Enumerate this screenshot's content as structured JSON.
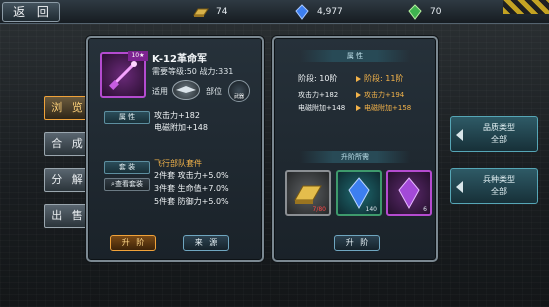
{
  "top": {
    "back_label": "返 回",
    "resources": [
      {
        "icon": "gold-bar-icon",
        "value": "74"
      },
      {
        "icon": "blue-crystal-icon",
        "value": "4,977"
      },
      {
        "icon": "green-crystal-icon",
        "value": "70"
      }
    ]
  },
  "tabs": [
    "浏 览",
    "合 成",
    "分 解",
    "出 售"
  ],
  "filters": [
    {
      "line1": "品质类型",
      "line2": "全部"
    },
    {
      "line1": "兵种类型",
      "line2": "全部"
    }
  ],
  "item": {
    "level_badge": "10★",
    "name": "K-12革命军",
    "req_line": "需要等级:50   战力:331",
    "fit_label": "适用",
    "part_label": "部位",
    "part_icon_text": "武器",
    "attr_tag": "属 性",
    "attack": "攻击力+182",
    "emp": "电磁附加+148",
    "set_tag": "套 装",
    "set_view": "查看套装",
    "set_name": "飞行部队套件",
    "set_bonus": [
      "2件套 攻击力+5.0%",
      "3件套 生命值+7.0%",
      "5件套 防御力+5.0%"
    ],
    "upgrade_btn": "升 阶",
    "source_btn": "来 源"
  },
  "upgrade": {
    "attr_title": "属 性",
    "stage_cur": "阶段: 10阶",
    "stage_next": "阶段: 11阶",
    "atk_cur": "攻击力+182",
    "atk_next": "攻击力+194",
    "emp_cur": "电磁附加+148",
    "emp_next": "电磁附加+158",
    "req_title": "升阶所需",
    "materials": [
      {
        "icon": "gold-bar-icon",
        "count": "7/80",
        "color": "#ff4a4a"
      },
      {
        "icon": "blue-crystal-icon",
        "count": "140",
        "color": "#ffffff"
      },
      {
        "icon": "purple-crystal-icon",
        "count": "6",
        "color": "#ffffff"
      }
    ],
    "upgrade_btn": "升 阶"
  }
}
